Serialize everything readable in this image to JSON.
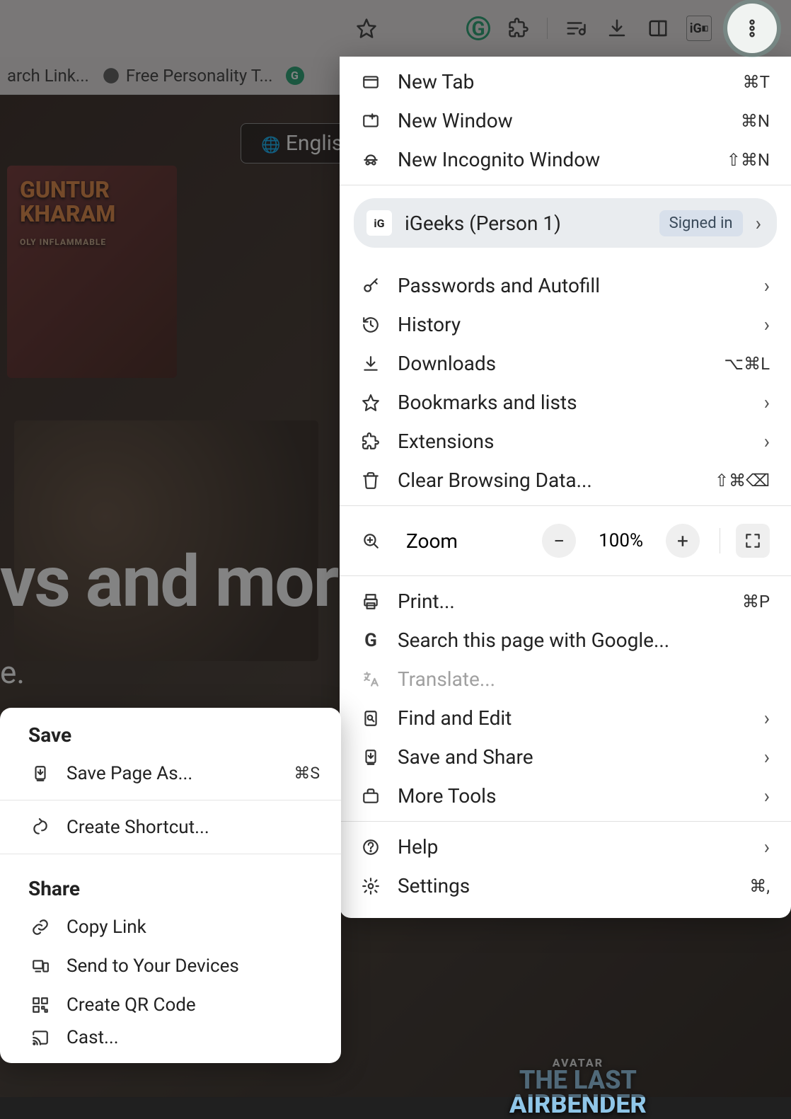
{
  "toolbar": {
    "star_tooltip": "Bookmark",
    "grammarly_icon": "G",
    "ig_text": "iG"
  },
  "bookmarks": {
    "item1": "arch Link...",
    "item2": "Free Personality T..."
  },
  "hero": {
    "language_button": "Englis",
    "title_fragment": "vs and mor",
    "subtitle_fragment": "e.",
    "poster1_line1": "GUNTUR",
    "poster1_line2": "KHARAM",
    "poster1_tag": "OLY INFLAMMABLE",
    "bottom_poster_small": "AVATAR",
    "bottom_poster_line1": "THE LAST",
    "bottom_poster_line2": "AIRBENDER"
  },
  "menu": {
    "new_tab": "New Tab",
    "new_tab_sc": "⌘T",
    "new_window": "New Window",
    "new_window_sc": "⌘N",
    "new_incognito": "New Incognito Window",
    "new_incognito_sc": "⇧⌘N",
    "profile_name": "iGeeks (Person 1)",
    "signed_in": "Signed in",
    "passwords": "Passwords and Autofill",
    "history": "History",
    "downloads": "Downloads",
    "downloads_sc": "⌥⌘L",
    "bookmarks": "Bookmarks and lists",
    "extensions": "Extensions",
    "clear": "Clear Browsing Data...",
    "clear_sc": "⇧⌘⌫",
    "zoom_label": "Zoom",
    "zoom_value": "100%",
    "print": "Print...",
    "print_sc": "⌘P",
    "search": "Search this page with Google...",
    "translate": "Translate...",
    "find": "Find and Edit",
    "save_share": "Save and Share",
    "more_tools": "More Tools",
    "help": "Help",
    "settings": "Settings",
    "settings_sc": "⌘,"
  },
  "submenu": {
    "save_header": "Save",
    "save_page": "Save Page As...",
    "save_page_sc": "⌘S",
    "create_shortcut": "Create Shortcut...",
    "share_header": "Share",
    "copy_link": "Copy Link",
    "send_devices": "Send to Your Devices",
    "create_qr": "Create QR Code",
    "cast": "Cast..."
  }
}
